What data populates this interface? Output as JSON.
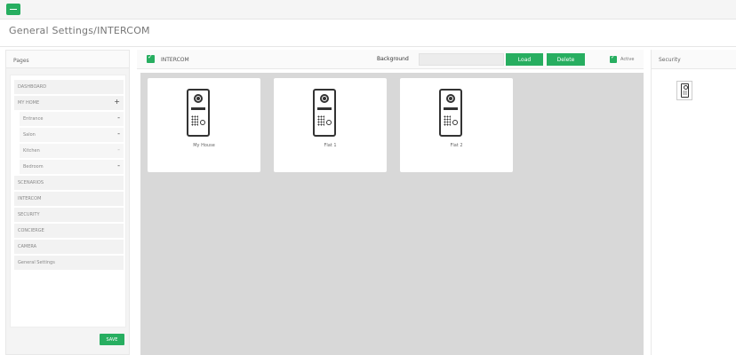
{
  "header": {
    "title": "General Settings/INTERCOM"
  },
  "pages": {
    "heading": "Pages",
    "items": [
      {
        "label": "DASHBOARD"
      },
      {
        "label": "MY HOME",
        "action": "+"
      },
      {
        "label": "Entrance",
        "action": "-",
        "sub": true
      },
      {
        "label": "Salon",
        "action": "-",
        "sub": true
      },
      {
        "label": "Kitchen",
        "action": "-",
        "sub": true
      },
      {
        "label": "Bedroom",
        "action": "-",
        "sub": true
      },
      {
        "label": "SCENARIOS"
      },
      {
        "label": "INTERCOM"
      },
      {
        "label": "SECURITY"
      },
      {
        "label": "CONCIERGE"
      },
      {
        "label": "CAMERA"
      },
      {
        "label": "General Settings"
      }
    ],
    "save_label": "SAVE"
  },
  "toolbar": {
    "intercom_label": "INTERCOM",
    "background_label": "Background",
    "background_value": "",
    "load_label": "Load",
    "delete_label": "Delete",
    "active_label": "Active",
    "active_checked": true
  },
  "cards": [
    {
      "label": "My House",
      "icon": "intercom-panel-icon"
    },
    {
      "label": "Flat 1",
      "icon": "intercom-panel-icon"
    },
    {
      "label": "Flat 2",
      "icon": "intercom-panel-icon"
    }
  ],
  "security": {
    "heading": "Security",
    "icon": "intercom-panel-icon"
  },
  "colors": {
    "accent": "#27ae60",
    "canvas": "#d8d8d8"
  }
}
